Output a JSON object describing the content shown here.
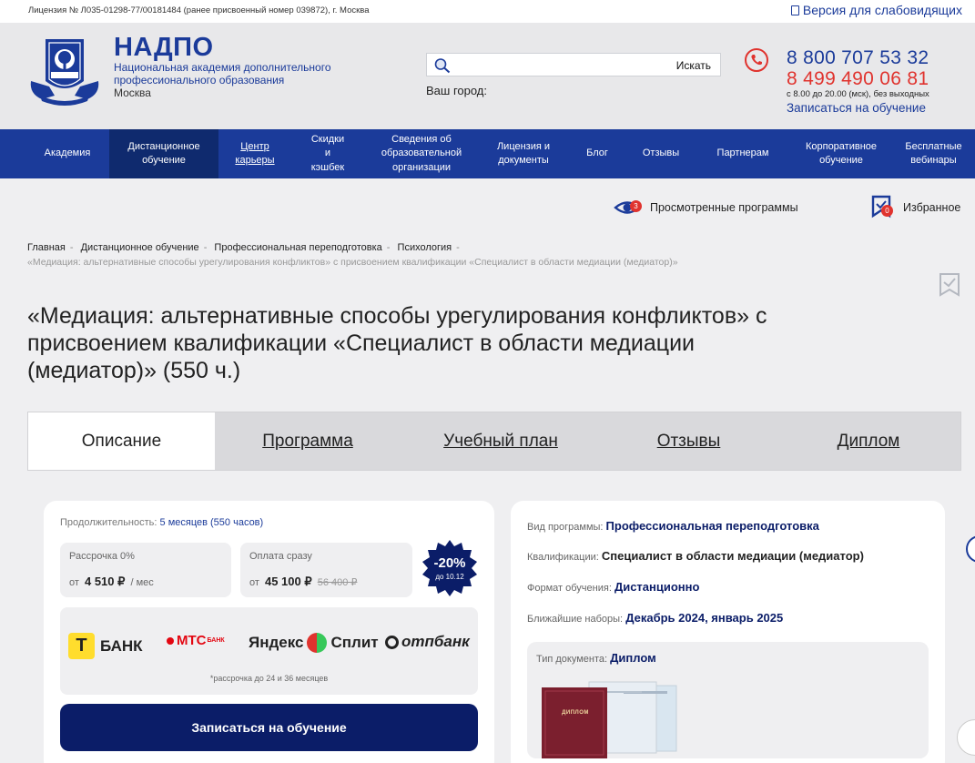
{
  "topbar": {
    "license": "Лицензия № Л035-01298-77/00181484 (ранее присвоенный номер 039872), г. Москва",
    "low_vision": "Версия для слабовидящих"
  },
  "brand": {
    "name": "НАДПО",
    "subtitle": "Национальная академия дополнительного профессионального образования",
    "city": "Москва"
  },
  "search": {
    "placeholder": "",
    "button": "Искать"
  },
  "city_label": "Ваш город:",
  "contacts": {
    "phone1": "8 800 707 53 32",
    "phone2": "8 499 490 06 81",
    "hours": "с 8.00 до 20.00 (мск), без выходных",
    "enroll_link": "Записаться на обучение"
  },
  "nav": [
    "Академия",
    "Дистанционное обучение",
    "Центр карьеры",
    "Скидки и кэшбек",
    "Сведения об образовательной организации",
    "Лицензия и документы",
    "Блог",
    "Отзывы",
    "Партнерам",
    "Корпоративное обучение",
    "Бесплатные вебинары"
  ],
  "user_tools": {
    "viewed_label": "Просмотренные программы",
    "viewed_count": "3",
    "favorites_label": "Избранное",
    "favorites_count": "0"
  },
  "breadcrumbs": {
    "items": [
      "Главная",
      "Дистанционное обучение",
      "Профессиональная переподготовка",
      "Психология"
    ],
    "current": "«Медиация: альтернативные способы урегулирования конфликтов» с присвоением квалификации «Специалист в области медиации (медиатор)»"
  },
  "title": "«Медиация: альтернативные способы урегулирования конфликтов» с присвоением квалификации «Специалист в области медиации (медиатор)» (550 ч.)",
  "tabs": [
    "Описание",
    "Программа",
    "Учебный план",
    "Отзывы",
    "Диплом"
  ],
  "pricing": {
    "duration_label": "Продолжительность:",
    "duration_value": "5 месяцев (550 часов)",
    "installment_title": "Рассрочка 0%",
    "installment_prefix": "от",
    "installment_amount": "4 510 ₽",
    "installment_suffix": "/ мес",
    "full_title": "Оплата сразу",
    "full_prefix": "от",
    "full_amount": "45 100 ₽",
    "full_old": "56 400 ₽",
    "discount": "-20%",
    "discount_until": "до 10.12",
    "banks": [
      "БАНК",
      "МТС",
      "БАНК",
      "Яндекс",
      "Сплит",
      "отпбанк"
    ],
    "banks_note": "*рассрочка до 24 и 36 месяцев",
    "enroll_button": "Записаться на обучение"
  },
  "program_info": {
    "type_label": "Вид программы:",
    "type_value": "Профессиональная переподготовка",
    "qual_label": "Квалификации:",
    "qual_value": "Специалист в области медиации (медиатор)",
    "format_label": "Формат обучения:",
    "format_value": "Дистанционно",
    "start_label": "Ближайшие наборы:",
    "start_value": "Декабрь 2024, январь 2025",
    "doc_label": "Тип документа:",
    "doc_value": "Диплом",
    "diploma_cover_text": "ДИПЛОМ"
  },
  "colors": {
    "brand_blue": "#1b3b9a",
    "nav_active": "#0f2a6e",
    "button_dark": "#0b1d68",
    "accent_red": "#e0332e",
    "page_bg": "#efeff1"
  }
}
